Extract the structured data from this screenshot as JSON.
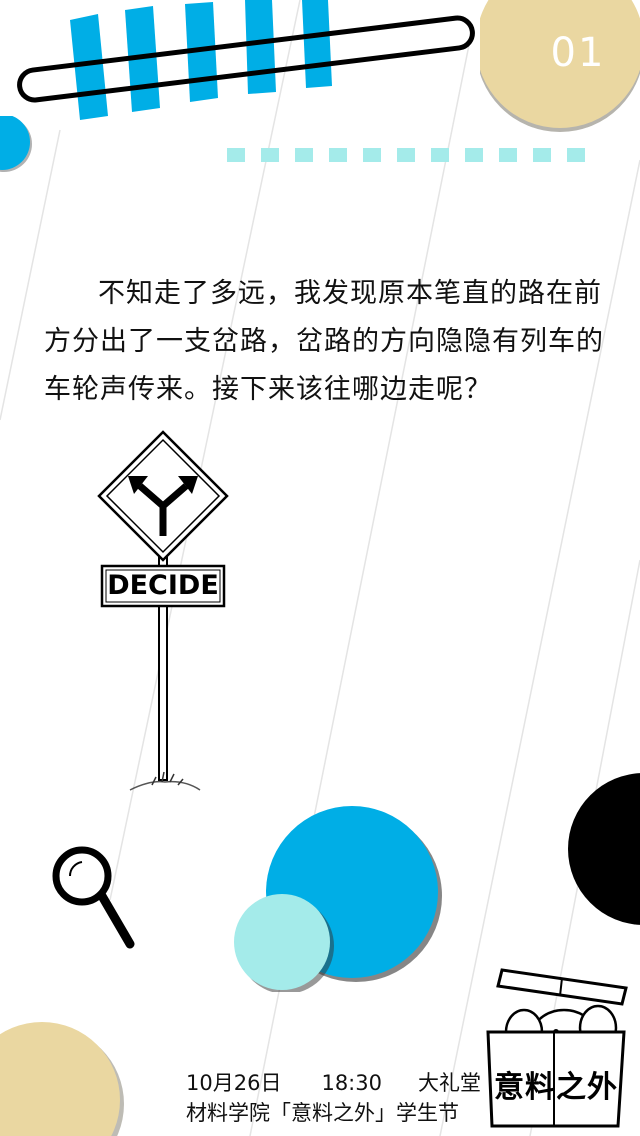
{
  "page_number": "01",
  "story": {
    "text": "不知走了多远，我发现原本笔直的路在前方分出了一支岔路，岔路的方向隐隐有列车的车轮声传来。接下来该往哪边走呢？"
  },
  "sign": {
    "label": "DECIDE"
  },
  "footer": {
    "date": "10月26日",
    "time": "18:30",
    "venue": "大礼堂",
    "event": "材料学院「意料之外」学生节"
  },
  "brand": {
    "text": "意料之外"
  },
  "colors": {
    "blue": "#00aee6",
    "light_cyan": "#a4ebea",
    "sand": "#ead7a1",
    "black": "#000000"
  },
  "icons": {
    "magnifier": "magnifier-icon",
    "fork_arrow": "fork-arrow-icon",
    "elephant_box": "elephant-box-icon"
  }
}
